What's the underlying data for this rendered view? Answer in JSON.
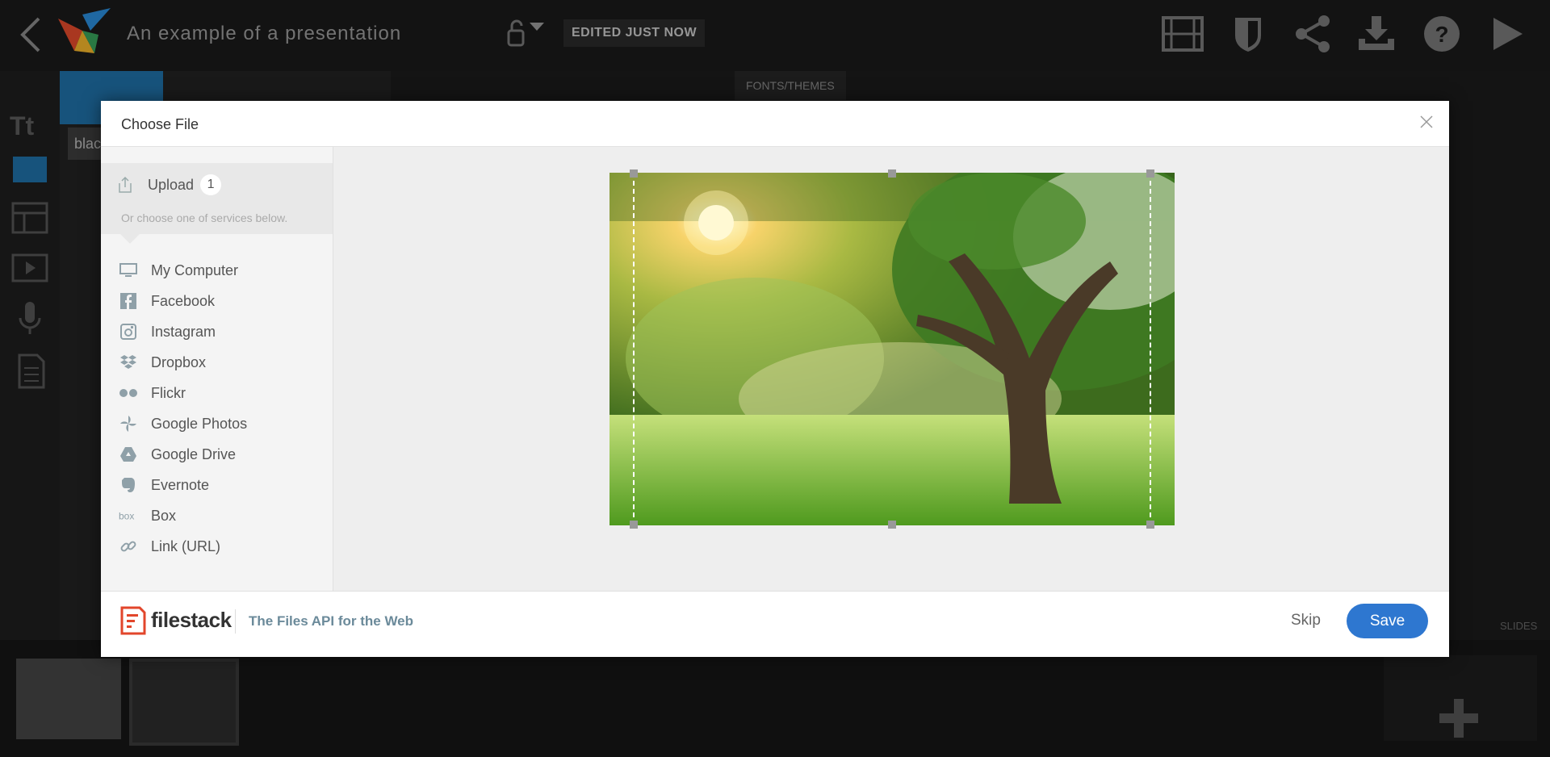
{
  "app": {
    "presentation_title": "An example of a presentation",
    "edited_status": "EDITED JUST NOW",
    "fonts_themes_label": "FONTS/THEMES",
    "slides_label": "SLIDES",
    "panel_search_value": "blac",
    "toolbar_icons": [
      "film-icon",
      "shield-icon",
      "share-icon",
      "download-icon",
      "help-icon",
      "play-icon"
    ],
    "rail_text_tool": "Tt"
  },
  "modal": {
    "title": "Choose File",
    "upload": {
      "label": "Upload",
      "count": "1",
      "hint": "Or choose one of services below."
    },
    "services": [
      {
        "label": "My Computer",
        "icon": "monitor-icon"
      },
      {
        "label": "Facebook",
        "icon": "facebook-icon"
      },
      {
        "label": "Instagram",
        "icon": "instagram-icon"
      },
      {
        "label": "Dropbox",
        "icon": "dropbox-icon"
      },
      {
        "label": "Flickr",
        "icon": "flickr-icon"
      },
      {
        "label": "Google Photos",
        "icon": "google-photos-icon"
      },
      {
        "label": "Google Drive",
        "icon": "google-drive-icon"
      },
      {
        "label": "Evernote",
        "icon": "evernote-icon"
      },
      {
        "label": "Box",
        "icon": "box-icon"
      },
      {
        "label": "Link (URL)",
        "icon": "link-icon"
      }
    ],
    "footer": {
      "brand_name": "filestack",
      "tagline": "The Files API for the Web",
      "skip_label": "Skip",
      "save_label": "Save"
    }
  },
  "colors": {
    "accent": "#2e77d0",
    "brand_red": "#e2462b",
    "active_tab": "#1f6fa6"
  }
}
